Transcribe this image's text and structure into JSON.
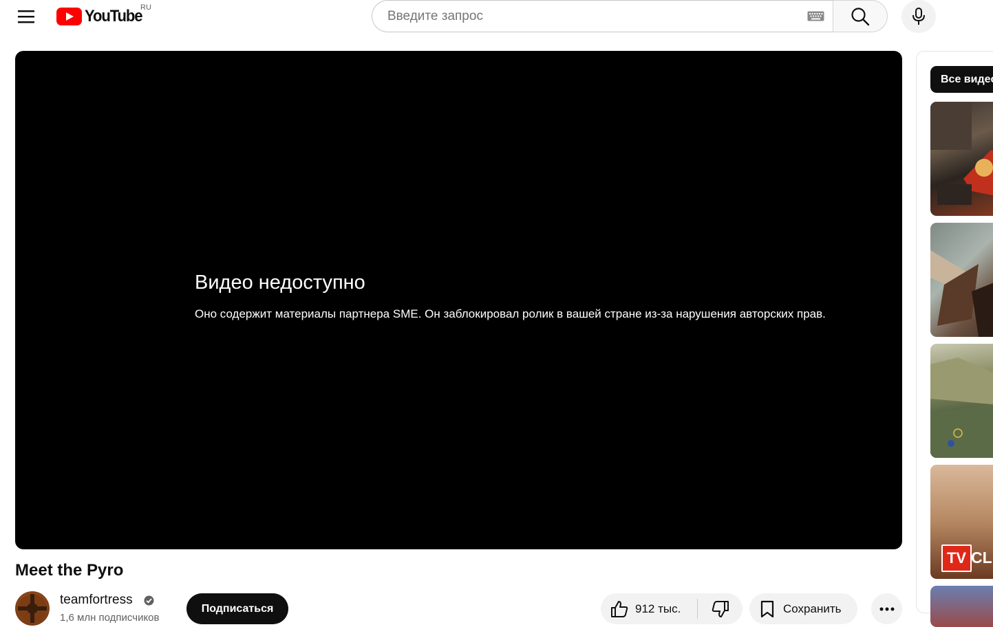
{
  "header": {
    "logo_text": "YouTube",
    "country_code": "RU",
    "search_placeholder": "Введите запрос",
    "search_value": ""
  },
  "player": {
    "error_title": "Видео недоступно",
    "error_message": "Оно содержит материалы партнера SME. Он заблокировал ролик в вашей стране из-за нарушения авторских прав."
  },
  "video": {
    "title": "Meet the Pyro",
    "channel_name": "teamfortress",
    "subscribers": "1,6 млн подписчиков",
    "subscribe_label": "Подписаться",
    "like_count": "912 тыс.",
    "save_label": "Сохранить"
  },
  "sidebar": {
    "chip_label": "Все видео",
    "thumbnail_overlay_badge": "TV",
    "thumbnail_overlay_text": "CL"
  },
  "colors": {
    "brand_red": "#ff0000",
    "subscribe_bg": "#0f0f0f",
    "chip_bg": "#f2f2f2"
  }
}
